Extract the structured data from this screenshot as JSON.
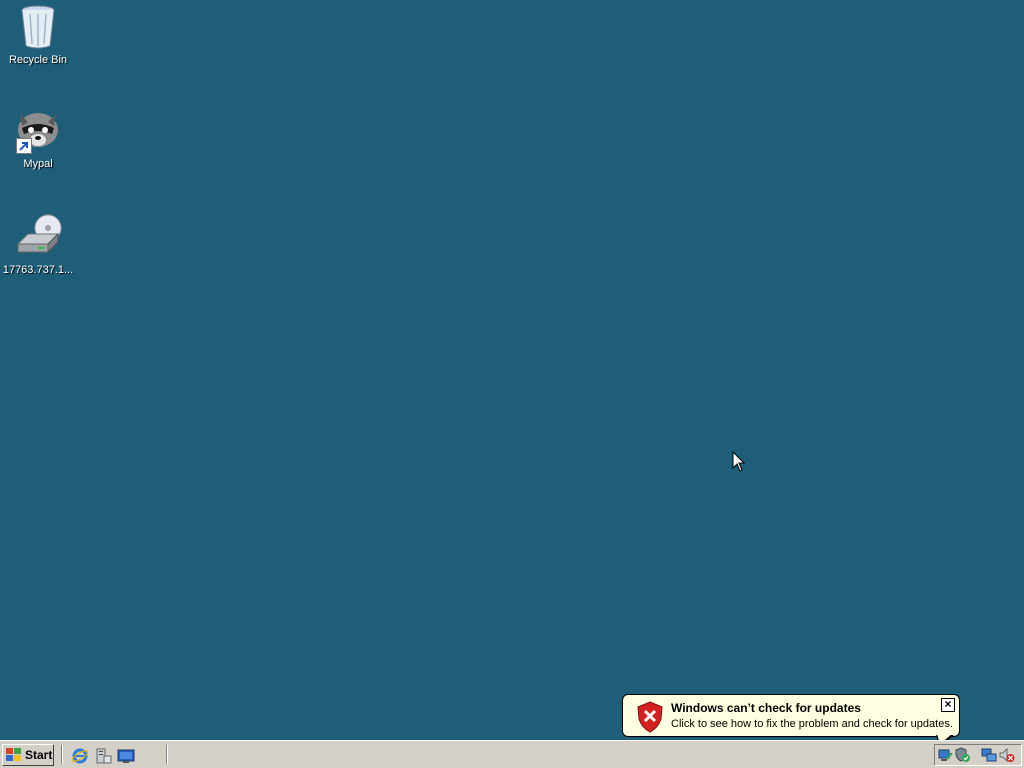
{
  "desktop": {
    "background_color": "#1f5e79",
    "icons": [
      {
        "label": "Recycle Bin",
        "icon": "recycle-bin-icon"
      },
      {
        "label": "Mypal",
        "icon": "raccoon-icon"
      },
      {
        "label": "17763.737.1...",
        "icon": "dvd-drive-icon"
      }
    ]
  },
  "notification": {
    "title": "Windows can’t check for updates",
    "message": "Click to see how to fix the problem and check for updates.",
    "icon": "security-shield-error-icon",
    "close_label": "×"
  },
  "taskbar": {
    "start_label": "Start",
    "quick_launch": [
      "internet-explorer-icon",
      "server-manager-icon",
      "show-desktop-icon"
    ],
    "tray_icons": [
      "network-icon",
      "security-shield-icon",
      "network-connection-icon",
      "volume-muted-icon"
    ]
  }
}
